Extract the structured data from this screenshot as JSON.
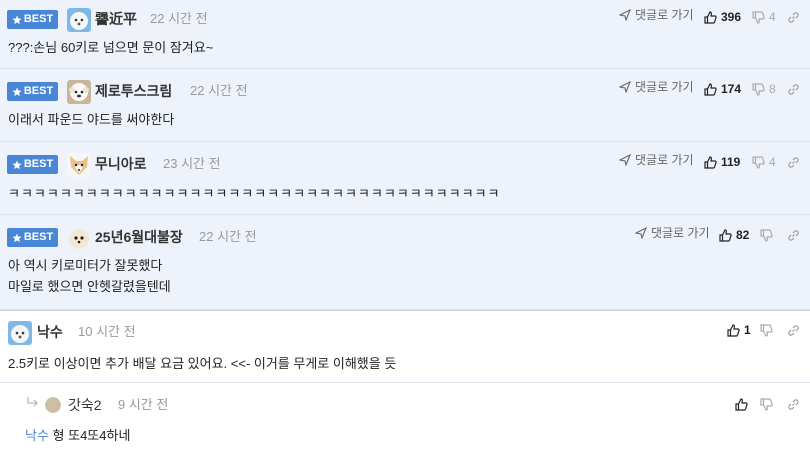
{
  "comments": [
    {
      "best_label": "BEST",
      "nickname": "謽近平",
      "time": "22 시간 전",
      "reply_label": "댓글로 가기",
      "likes": "396",
      "dislikes": "4",
      "lines": [
        "???:손님 60키로 넘으면 문이 잠겨요~"
      ],
      "avatar": "white-dog-avatar"
    },
    {
      "best_label": "BEST",
      "nickname": "제로투스크림",
      "time": "22 시간 전",
      "reply_label": "댓글로 가기",
      "likes": "174",
      "dislikes": "8",
      "lines": [
        "이래서 파운드 야드를 써야한다"
      ],
      "avatar": "white-puppy-avatar"
    },
    {
      "best_label": "BEST",
      "nickname": "무니아로",
      "time": "23 시간 전",
      "reply_label": "댓글로 가기",
      "likes": "119",
      "dislikes": "4",
      "lines": [
        "ㅋㅋㅋㅋㅋㅋㅋㅋㅋㅋㅋㅋㅋㅋㅋㅋㅋㅋㅋㅋㅋㅋㅋㅋㅋㅋㅋㅋㅋㅋㅋㅋㅋㅋㅋㅋㅋㅋ"
      ],
      "avatar": "fox-avatar"
    },
    {
      "best_label": "BEST",
      "nickname": "25년6월대불장",
      "time": "22 시간 전",
      "reply_label": "댓글로 가기",
      "likes": "82",
      "dislikes": "",
      "lines": [
        "아 역시 키로미터가 잘못했다",
        "마일로 했으면 안헷갈렸을텐데"
      ],
      "avatar": "fluffy-dog-avatar"
    },
    {
      "nickname": "낙수",
      "time": "10 시간 전",
      "likes": "1",
      "dislikes": "",
      "lines": [
        "2.5키로 이상이면 추가 배달 요금 있어요. <<- 이거를 무게로 이해했을 듯"
      ],
      "avatar": "white-dog-avatar"
    },
    {
      "nickname": "갓숙2",
      "time": "9 시간 전",
      "likes": "",
      "dislikes": "",
      "mention": "낙수",
      "text": "형 또4또4하네",
      "avatar": "default-circle-avatar"
    }
  ],
  "colors": {
    "best_bg": "#eef3fb",
    "badge": "#4a86d6",
    "border": "#dde3ec"
  }
}
